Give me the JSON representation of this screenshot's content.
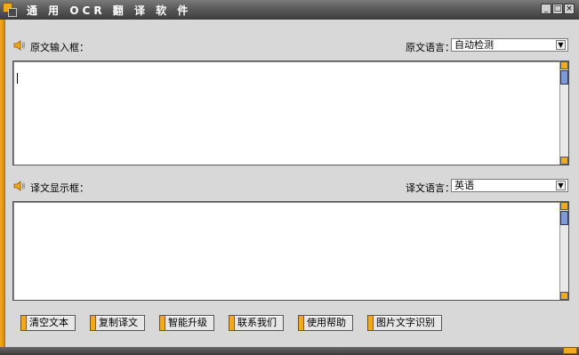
{
  "window": {
    "title": "通 用 OCR 翻 译 软 件",
    "controls": [
      "_",
      "□",
      "×"
    ]
  },
  "source": {
    "label": "原文输入框：",
    "lang_label": "原文语言：",
    "lang_value": "自动检测",
    "text": ""
  },
  "target": {
    "label": "译文显示框：",
    "lang_label": "译文语言：",
    "lang_value": "英语",
    "text": ""
  },
  "buttons": {
    "clear": "清空文本",
    "copy": "复制译文",
    "upgrade": "智能升级",
    "contact": "联系我们",
    "help": "使用帮助",
    "ocr": "图片文字识别"
  },
  "colors": {
    "accent": "#f2a91a",
    "window_bg": "#d8d8d8",
    "titlebar": "#4a4a4a"
  },
  "icons": {
    "app": "app-logo-icon",
    "speaker": "speaker-icon",
    "dropdown": "chevron-down-icon"
  }
}
